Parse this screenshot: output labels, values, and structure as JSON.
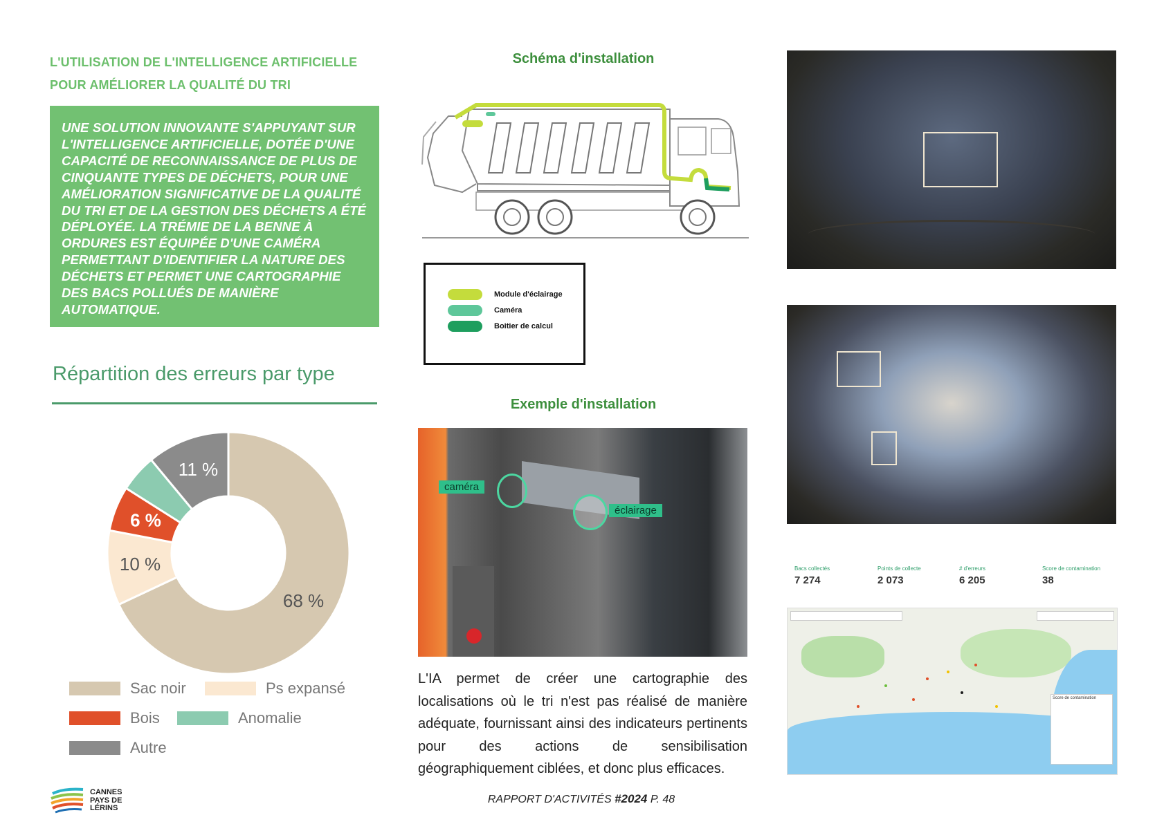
{
  "section": {
    "title": "L'UTILISATION DE L'INTELLIGENCE ARTIFICIELLE POUR AMÉLIORER LA QUALITÉ DU TRI",
    "highlight": "UNE SOLUTION INNOVANTE S'APPUYANT SUR L'INTELLIGENCE ARTIFICIELLE, DOTÉE D'UNE CAPACITÉ DE RECONNAISSANCE DE PLUS DE CINQUANTE TYPES DE DÉCHETS, POUR UNE AMÉLIORATION SIGNIFICATIVE DE LA QUALITÉ DU TRI ET DE LA GESTION DES DÉCHETS A ÉTÉ DÉPLOYÉE. LA TRÉMIE DE LA BENNE À ORDURES EST ÉQUIPÉE D'UNE CAMÉRA PERMETTANT D'IDENTIFIER LA NATURE DES DÉCHETS ET PERMET UNE CARTOGRAPHIE DES BACS POLLUÉS DE MANIÈRE AUTOMATIQUE."
  },
  "chart_data": {
    "type": "pie",
    "title": "Répartition des erreurs par type",
    "labels": [
      "Sac noir",
      "Ps expansé",
      "Bois",
      "Anomalie",
      "Autre"
    ],
    "values": [
      68,
      10,
      6,
      5,
      11
    ],
    "value_labels": [
      "68 %",
      "10 %",
      "6 %",
      "",
      "11 %"
    ],
    "colors": [
      "#d6c8b0",
      "#fbe8d1",
      "#e0502a",
      "#8ccbb0",
      "#8b8b8b"
    ],
    "donut": true,
    "legend_position": "bottom"
  },
  "schema": {
    "title": "Schéma d'installation",
    "legend": [
      {
        "label": "Module d'éclairage",
        "color": "#c4dc3c"
      },
      {
        "label": "Caméra",
        "color": "#5ec79a"
      },
      {
        "label": "Boitier de calcul",
        "color": "#1e9e5e"
      }
    ]
  },
  "example": {
    "title": "Exemple d'installation",
    "tags": [
      "caméra",
      "éclairage"
    ]
  },
  "body_text": "L'IA permet de créer une cartographie des localisations où le tri n'est pas réalisé de manière adéquate, fournissant ainsi des indicateurs pertinents pour des actions de sensibilisation géographiquement ciblées, et donc plus efficaces.",
  "dashboard": {
    "stats": [
      {
        "label": "Bacs collectés",
        "value": "7 274"
      },
      {
        "label": "Points de collecte",
        "value": "2 073"
      },
      {
        "label": "# d'erreurs",
        "value": "6 205"
      },
      {
        "label": "Score de contamination",
        "value": "38"
      }
    ],
    "map_legend_title": "Score de contamination"
  },
  "footer": {
    "prefix": "RAPPORT D'ACTIVITÉS ",
    "number": "#2024",
    "page": " P. 48"
  },
  "logo": {
    "line1": "CANNES",
    "line2": "PAYS DE",
    "line3": "LÉRINS"
  }
}
